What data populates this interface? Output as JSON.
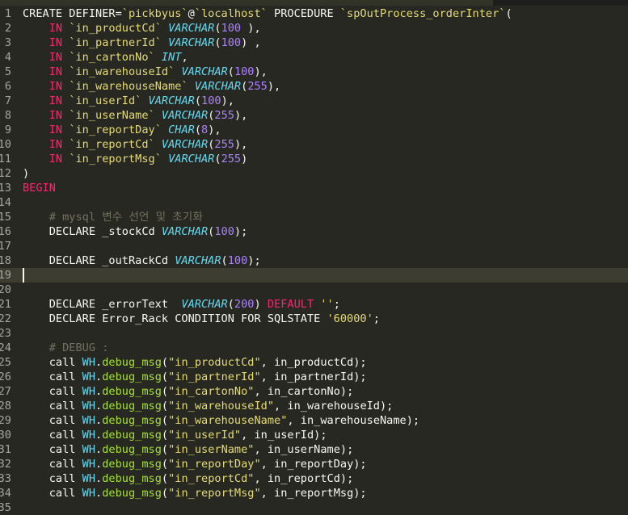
{
  "editor": {
    "lines": [
      {
        "n": "1",
        "t": [
          [
            "k",
            "CREATE DEFINER="
          ],
          [
            "str",
            "`pickbyus`"
          ],
          [
            "k",
            "@"
          ],
          [
            "str",
            "`localhost`"
          ],
          [
            "k",
            " PROCEDURE "
          ],
          [
            "str",
            "`spOutProcess_orderInter`"
          ],
          [
            "k",
            "("
          ]
        ]
      },
      {
        "n": "2",
        "t": [
          [
            "k",
            "    "
          ],
          [
            "kw",
            "IN"
          ],
          [
            "k",
            " "
          ],
          [
            "str",
            "`in_productCd`"
          ],
          [
            "k",
            " "
          ],
          [
            "ty",
            "VARCHAR"
          ],
          [
            "k",
            "("
          ],
          [
            "num",
            "100"
          ],
          [
            "k",
            " ),"
          ]
        ]
      },
      {
        "n": "3",
        "t": [
          [
            "k",
            "    "
          ],
          [
            "kw",
            "IN"
          ],
          [
            "k",
            " "
          ],
          [
            "str",
            "`in_partnerId`"
          ],
          [
            "k",
            " "
          ],
          [
            "ty",
            "VARCHAR"
          ],
          [
            "k",
            "("
          ],
          [
            "num",
            "100"
          ],
          [
            "k",
            ") ,"
          ]
        ]
      },
      {
        "n": "4",
        "t": [
          [
            "k",
            "    "
          ],
          [
            "kw",
            "IN"
          ],
          [
            "k",
            " "
          ],
          [
            "str",
            "`in_cartonNo`"
          ],
          [
            "k",
            " "
          ],
          [
            "ty",
            "INT"
          ],
          [
            "k",
            ","
          ]
        ]
      },
      {
        "n": "5",
        "t": [
          [
            "k",
            "    "
          ],
          [
            "kw",
            "IN"
          ],
          [
            "k",
            " "
          ],
          [
            "str",
            "`in_warehouseId`"
          ],
          [
            "k",
            " "
          ],
          [
            "ty",
            "VARCHAR"
          ],
          [
            "k",
            "("
          ],
          [
            "num",
            "100"
          ],
          [
            "k",
            "),"
          ]
        ]
      },
      {
        "n": "6",
        "t": [
          [
            "k",
            "    "
          ],
          [
            "kw",
            "IN"
          ],
          [
            "k",
            " "
          ],
          [
            "str",
            "`in_warehouseName`"
          ],
          [
            "k",
            " "
          ],
          [
            "ty",
            "VARCHAR"
          ],
          [
            "k",
            "("
          ],
          [
            "num",
            "255"
          ],
          [
            "k",
            "),"
          ]
        ]
      },
      {
        "n": "7",
        "t": [
          [
            "k",
            "    "
          ],
          [
            "kw",
            "IN"
          ],
          [
            "k",
            " "
          ],
          [
            "str",
            "`in_userId`"
          ],
          [
            "k",
            " "
          ],
          [
            "ty",
            "VARCHAR"
          ],
          [
            "k",
            "("
          ],
          [
            "num",
            "100"
          ],
          [
            "k",
            "),"
          ]
        ]
      },
      {
        "n": "8",
        "t": [
          [
            "k",
            "    "
          ],
          [
            "kw",
            "IN"
          ],
          [
            "k",
            " "
          ],
          [
            "str",
            "`in_userName`"
          ],
          [
            "k",
            " "
          ],
          [
            "ty",
            "VARCHAR"
          ],
          [
            "k",
            "("
          ],
          [
            "num",
            "255"
          ],
          [
            "k",
            "),"
          ]
        ]
      },
      {
        "n": "9",
        "t": [
          [
            "k",
            "    "
          ],
          [
            "kw",
            "IN"
          ],
          [
            "k",
            " "
          ],
          [
            "str",
            "`in_reportDay`"
          ],
          [
            "k",
            " "
          ],
          [
            "ty",
            "CHAR"
          ],
          [
            "k",
            "("
          ],
          [
            "num",
            "8"
          ],
          [
            "k",
            "),"
          ]
        ]
      },
      {
        "n": "10",
        "t": [
          [
            "k",
            "    "
          ],
          [
            "kw",
            "IN"
          ],
          [
            "k",
            " "
          ],
          [
            "str",
            "`in_reportCd`"
          ],
          [
            "k",
            " "
          ],
          [
            "ty",
            "VARCHAR"
          ],
          [
            "k",
            "("
          ],
          [
            "num",
            "255"
          ],
          [
            "k",
            "),"
          ]
        ]
      },
      {
        "n": "11",
        "t": [
          [
            "k",
            "    "
          ],
          [
            "kw",
            "IN"
          ],
          [
            "k",
            " "
          ],
          [
            "str",
            "`in_reportMsg`"
          ],
          [
            "k",
            " "
          ],
          [
            "ty",
            "VARCHAR"
          ],
          [
            "k",
            "("
          ],
          [
            "num",
            "255"
          ],
          [
            "k",
            ")"
          ]
        ]
      },
      {
        "n": "12",
        "t": [
          [
            "k",
            ")"
          ]
        ]
      },
      {
        "n": "13",
        "t": [
          [
            "kw",
            "BEGIN"
          ]
        ]
      },
      {
        "n": "14",
        "t": []
      },
      {
        "n": "15",
        "t": [
          [
            "k",
            "    "
          ],
          [
            "cmt",
            "# mysql 변수 선언 및 초기화"
          ]
        ]
      },
      {
        "n": "16",
        "t": [
          [
            "k",
            "    DECLARE _stockCd "
          ],
          [
            "ty",
            "VARCHAR"
          ],
          [
            "k",
            "("
          ],
          [
            "num",
            "100"
          ],
          [
            "k",
            ");"
          ]
        ]
      },
      {
        "n": "17",
        "t": []
      },
      {
        "n": "18",
        "t": [
          [
            "k",
            "    DECLARE _outRackCd "
          ],
          [
            "ty",
            "VARCHAR"
          ],
          [
            "k",
            "("
          ],
          [
            "num",
            "100"
          ],
          [
            "k",
            ");"
          ]
        ]
      },
      {
        "n": "19",
        "t": [],
        "active": true
      },
      {
        "n": "20",
        "t": []
      },
      {
        "n": "21",
        "t": [
          [
            "k",
            "    DECLARE _errorText  "
          ],
          [
            "ty",
            "VARCHAR"
          ],
          [
            "k",
            "("
          ],
          [
            "num",
            "200"
          ],
          [
            "k",
            ") "
          ],
          [
            "kw",
            "DEFAULT"
          ],
          [
            "k",
            " "
          ],
          [
            "str",
            "''"
          ],
          [
            "k",
            ";"
          ]
        ]
      },
      {
        "n": "22",
        "t": [
          [
            "k",
            "    DECLARE Error_Rack CONDITION FOR SQLSTATE "
          ],
          [
            "str",
            "'60000'"
          ],
          [
            "k",
            ";"
          ]
        ]
      },
      {
        "n": "23",
        "t": []
      },
      {
        "n": "24",
        "t": [
          [
            "k",
            "    "
          ],
          [
            "cmt",
            "# DEBUG :"
          ]
        ]
      },
      {
        "n": "25",
        "t": [
          [
            "k",
            "    call "
          ],
          [
            "obj",
            "WH"
          ],
          [
            "k",
            "."
          ],
          [
            "fn",
            "debug_msg"
          ],
          [
            "k",
            "("
          ],
          [
            "str",
            "\"in_productCd\""
          ],
          [
            "k",
            ", in_productCd);"
          ]
        ]
      },
      {
        "n": "26",
        "t": [
          [
            "k",
            "    call "
          ],
          [
            "obj",
            "WH"
          ],
          [
            "k",
            "."
          ],
          [
            "fn",
            "debug_msg"
          ],
          [
            "k",
            "("
          ],
          [
            "str",
            "\"in_partnerId\""
          ],
          [
            "k",
            ", in_partnerId);"
          ]
        ]
      },
      {
        "n": "27",
        "t": [
          [
            "k",
            "    call "
          ],
          [
            "obj",
            "WH"
          ],
          [
            "k",
            "."
          ],
          [
            "fn",
            "debug_msg"
          ],
          [
            "k",
            "("
          ],
          [
            "str",
            "\"in_cartonNo\""
          ],
          [
            "k",
            ", in_cartonNo);"
          ]
        ]
      },
      {
        "n": "28",
        "t": [
          [
            "k",
            "    call "
          ],
          [
            "obj",
            "WH"
          ],
          [
            "k",
            "."
          ],
          [
            "fn",
            "debug_msg"
          ],
          [
            "k",
            "("
          ],
          [
            "str",
            "\"in_warehouseId\""
          ],
          [
            "k",
            ", in_warehouseId);"
          ]
        ]
      },
      {
        "n": "29",
        "t": [
          [
            "k",
            "    call "
          ],
          [
            "obj",
            "WH"
          ],
          [
            "k",
            "."
          ],
          [
            "fn",
            "debug_msg"
          ],
          [
            "k",
            "("
          ],
          [
            "str",
            "\"in_warehouseName\""
          ],
          [
            "k",
            ", in_warehouseName);"
          ]
        ]
      },
      {
        "n": "30",
        "t": [
          [
            "k",
            "    call "
          ],
          [
            "obj",
            "WH"
          ],
          [
            "k",
            "."
          ],
          [
            "fn",
            "debug_msg"
          ],
          [
            "k",
            "("
          ],
          [
            "str",
            "\"in_userId\""
          ],
          [
            "k",
            ", in_userId);"
          ]
        ]
      },
      {
        "n": "31",
        "t": [
          [
            "k",
            "    call "
          ],
          [
            "obj",
            "WH"
          ],
          [
            "k",
            "."
          ],
          [
            "fn",
            "debug_msg"
          ],
          [
            "k",
            "("
          ],
          [
            "str",
            "\"in_userName\""
          ],
          [
            "k",
            ", in_userName);"
          ]
        ]
      },
      {
        "n": "32",
        "t": [
          [
            "k",
            "    call "
          ],
          [
            "obj",
            "WH"
          ],
          [
            "k",
            "."
          ],
          [
            "fn",
            "debug_msg"
          ],
          [
            "k",
            "("
          ],
          [
            "str",
            "\"in_reportDay\""
          ],
          [
            "k",
            ", in_reportDay);"
          ]
        ]
      },
      {
        "n": "33",
        "t": [
          [
            "k",
            "    call "
          ],
          [
            "obj",
            "WH"
          ],
          [
            "k",
            "."
          ],
          [
            "fn",
            "debug_msg"
          ],
          [
            "k",
            "("
          ],
          [
            "str",
            "\"in_reportCd\""
          ],
          [
            "k",
            ", in_reportCd);"
          ]
        ]
      },
      {
        "n": "34",
        "t": [
          [
            "k",
            "    call "
          ],
          [
            "obj",
            "WH"
          ],
          [
            "k",
            "."
          ],
          [
            "fn",
            "debug_msg"
          ],
          [
            "k",
            "("
          ],
          [
            "str",
            "\"in_reportMsg\""
          ],
          [
            "k",
            ", in_reportMsg);"
          ]
        ]
      },
      {
        "n": "35",
        "t": []
      }
    ]
  },
  "colors": {
    "background": "#272822",
    "keyword": "#f92672",
    "type": "#66d9ef",
    "number": "#ae81ff",
    "string": "#e6db74",
    "comment": "#75715e",
    "function": "#a6e22e"
  }
}
